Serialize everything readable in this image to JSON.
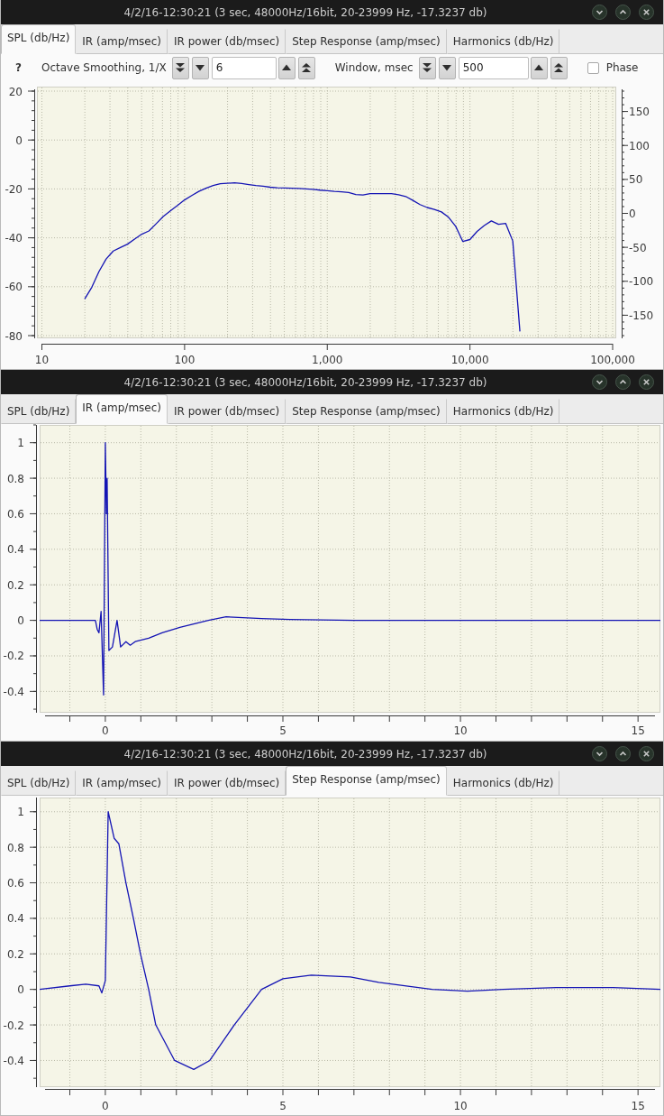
{
  "windows": [
    {
      "title": "4/2/16-12:30:21 (3 sec, 48000Hz/16bit, 20-23999 Hz, -17.3237 db)",
      "tabs": [
        {
          "label": "SPL (db/Hz)",
          "selected": true
        },
        {
          "label": "IR (amp/msec)",
          "selected": false
        },
        {
          "label": "IR power (db/msec)",
          "selected": false
        },
        {
          "label": "Step Response (amp/msec)",
          "selected": false
        },
        {
          "label": "Harmonics (db/Hz)",
          "selected": false
        }
      ],
      "toolbar": {
        "help": "?",
        "controls": [
          {
            "kind": "spinner",
            "label": "Octave Smoothing, 1/X",
            "value": "6"
          },
          {
            "kind": "spinner",
            "label": "Window, msec",
            "value": "500"
          },
          {
            "kind": "checkbox",
            "label": "Phase",
            "checked": false
          }
        ]
      },
      "plot": {
        "chart_data": {
          "type": "line",
          "categories": [
            "10",
            null,
            null,
            null,
            null,
            null,
            null,
            null,
            null,
            null,
            null,
            null,
            null,
            null,
            null,
            null,
            null,
            null,
            null,
            null,
            "100",
            null,
            null,
            null,
            null,
            null,
            null,
            null,
            null,
            null,
            null,
            null,
            null,
            null,
            null,
            null,
            null,
            null,
            null,
            null,
            "1,000",
            null,
            null,
            null,
            null,
            null,
            null,
            null,
            null,
            null,
            null,
            null,
            null,
            null,
            null,
            null,
            null,
            null,
            null,
            null,
            "10,000",
            null,
            null,
            null,
            null,
            null,
            null,
            null,
            null,
            null,
            null,
            null,
            null,
            null,
            null,
            null,
            null,
            null,
            null,
            null,
            "100,000"
          ],
          "series": [
            {
              "color": "#1414b4",
              "values": [
                null,
                null,
                null,
                null,
                null,
                null,
                -65,
                -60.2,
                -53.8,
                -48.7,
                -45.4,
                -44,
                -42.6,
                -40.5,
                -38.5,
                -37.2,
                -34.3,
                -31.3,
                -29,
                -26.8,
                -24.5,
                -22.7,
                -21,
                -19.7,
                -18.6,
                -17.9,
                -17.7,
                -17.5,
                -17.8,
                -18.2,
                -18.6,
                -18.9,
                -19.3,
                -19.5,
                -19.6,
                -19.7,
                -19.8,
                -20,
                -20.2,
                -20.5,
                -20.7,
                -21,
                -21.2,
                -21.5,
                -22.3,
                -22.5,
                -21.9,
                -21.9,
                -21.9,
                -21.9,
                -22.4,
                -23.1,
                -24.7,
                -26.4,
                -27.6,
                -28.4,
                -29.4,
                -31.6,
                -35.3,
                -41.5,
                -40.7,
                -37.4,
                -35,
                -33.1,
                -34.5,
                -34.1,
                -41.3,
                -78.3,
                null,
                null,
                null,
                null,
                null,
                null,
                null,
                null,
                null,
                null,
                null,
                null,
                null
              ]
            }
          ],
          "ylim": [
            -80,
            20
          ],
          "yticks": [
            -80,
            -60,
            -40,
            -20,
            0,
            20
          ],
          "y2lim": [
            -180,
            180
          ],
          "y2ticks": [
            -150,
            -100,
            -50,
            0,
            50,
            100,
            150
          ],
          "grid": true
        }
      }
    },
    {
      "title": "4/2/16-12:30:21 (3 sec, 48000Hz/16bit, 20-23999 Hz, -17.3237 db)",
      "tabs": [
        {
          "label": "SPL (db/Hz)",
          "selected": false
        },
        {
          "label": "IR (amp/msec)",
          "selected": true
        },
        {
          "label": "IR power (db/msec)",
          "selected": false
        },
        {
          "label": "Step Response (amp/msec)",
          "selected": false
        },
        {
          "label": "Harmonics (db/Hz)",
          "selected": false
        }
      ],
      "plot": {
        "chart_data": {
          "type": "line",
          "x": [
            -1.85,
            -0.5,
            -0.28,
            -0.23,
            -0.18,
            -0.12,
            -0.05,
            0,
            0.03,
            0.05,
            0.1,
            0.2,
            0.33,
            0.43,
            0.58,
            0.7,
            0.84,
            1.22,
            1.6,
            2.1,
            2.9,
            3.4,
            4.4,
            5.2,
            7,
            10,
            13,
            15.63
          ],
          "series": [
            {
              "color": "#1414b4",
              "values": [
                0,
                0,
                0,
                -0.05,
                -0.07,
                0.05,
                -0.42,
                1,
                0.6,
                0.8,
                -0.17,
                -0.15,
                0,
                -0.15,
                -0.12,
                -0.14,
                -0.12,
                -0.1,
                -0.07,
                -0.04,
                0,
                0.02,
                0.01,
                0.005,
                0,
                0,
                0,
                0
              ]
            }
          ],
          "xlim": [
            -1.85,
            15.63
          ],
          "ylim": [
            -0.52,
            1.1
          ],
          "xticks": [
            0,
            5,
            10,
            15
          ],
          "yticks": [
            -0.4,
            -0.2,
            0,
            0.2,
            0.4,
            0.6,
            0.8,
            1
          ],
          "grid": true
        }
      }
    },
    {
      "title": "4/2/16-12:30:21 (3 sec, 48000Hz/16bit, 20-23999 Hz, -17.3237 db)",
      "tabs": [
        {
          "label": "SPL (db/Hz)",
          "selected": false
        },
        {
          "label": "IR (amp/msec)",
          "selected": false
        },
        {
          "label": "IR power (db/msec)",
          "selected": false
        },
        {
          "label": "Step Response (amp/msec)",
          "selected": true
        },
        {
          "label": "Harmonics (db/Hz)",
          "selected": false
        }
      ],
      "plot": {
        "chart_data": {
          "type": "line",
          "x": [
            -1.85,
            -1,
            -0.55,
            -0.18,
            -0.1,
            0,
            0.08,
            0.25,
            0.38,
            0.58,
            0.79,
            0.99,
            1.22,
            1.42,
            1.95,
            2.49,
            2.94,
            3.63,
            4.4,
            5,
            5.8,
            6.9,
            7.7,
            9.2,
            10.2,
            11.2,
            12.7,
            14.3,
            15.63
          ],
          "series": [
            {
              "color": "#1414b4",
              "values": [
                0,
                0.02,
                0.03,
                0.02,
                -0.02,
                0.05,
                1,
                0.85,
                0.82,
                0.6,
                0.4,
                0.2,
                0,
                -0.2,
                -0.4,
                -0.45,
                -0.4,
                -0.2,
                0,
                0.06,
                0.08,
                0.07,
                0.04,
                0,
                -0.01,
                0,
                0.01,
                0.01,
                0
              ]
            }
          ],
          "xlim": [
            -1.85,
            15.63
          ],
          "ylim": [
            -0.55,
            1.08
          ],
          "xticks": [
            0,
            5,
            10,
            15
          ],
          "yticks": [
            -0.4,
            -0.2,
            0,
            0.2,
            0.4,
            0.6,
            0.8,
            1
          ],
          "grid": true
        }
      }
    }
  ]
}
